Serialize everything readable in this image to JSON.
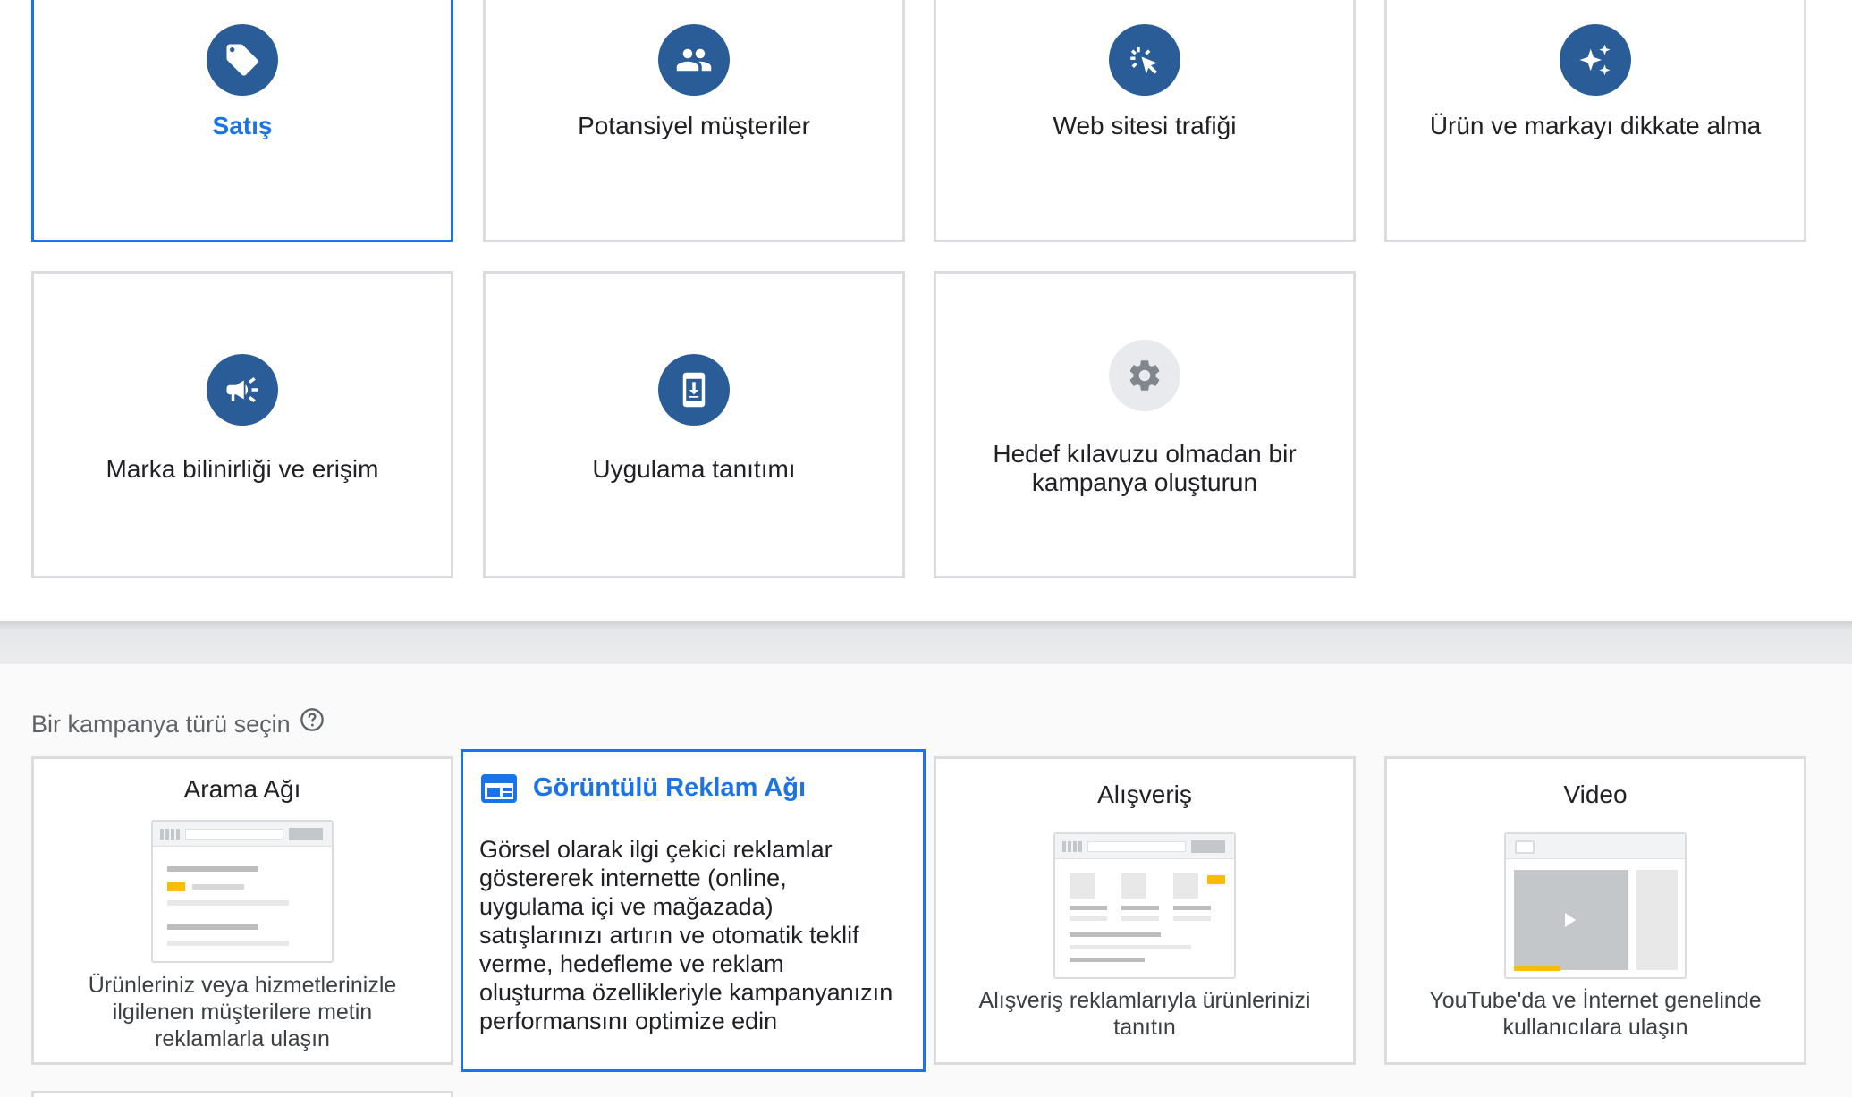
{
  "goals": [
    {
      "label": "Satış",
      "icon": "tag-icon",
      "selected": true
    },
    {
      "label": "Potansiyel müşteriler",
      "icon": "people-icon",
      "selected": false
    },
    {
      "label": "Web sitesi trafiği",
      "icon": "cursor-click-icon",
      "selected": false
    },
    {
      "label": "Ürün ve markayı dikkate alma",
      "icon": "sparkle-icon",
      "selected": false
    },
    {
      "label": "Marka bilinirliği ve erişim",
      "icon": "megaphone-icon",
      "selected": false
    },
    {
      "label": "Uygulama tanıtımı",
      "icon": "phone-download-icon",
      "selected": false
    },
    {
      "label_line1": "Hedef kılavuzu olmadan bir",
      "label_line2": "kampanya oluşturun",
      "icon": "gear-icon",
      "selected": false
    }
  ],
  "campaign_section": {
    "title": "Bir kampanya türü seçin",
    "help_icon": "help-circle-icon"
  },
  "campaign_types": [
    {
      "title": "Arama Ağı",
      "desc": [
        "Ürünleriniz veya hizmetlerinizle",
        "ilgilenen müşterilere metin",
        "reklamlarla ulaşın"
      ]
    },
    {
      "title": "Görüntülü Reklam Ağı",
      "icon": "display-network-icon",
      "selected": true,
      "desc": [
        "Görsel olarak ilgi çekici reklamlar",
        "göstererek internette (online,",
        "uygulama içi ve mağazada)",
        "satışlarınızı artırın ve otomatik teklif",
        "verme, hedefleme ve reklam",
        "oluşturma özellikleriyle kampanyanızın",
        "performansını optimize edin"
      ]
    },
    {
      "title": "Alışveriş",
      "desc": [
        "Alışveriş reklamlarıyla ürünlerinizi",
        "tanıtın"
      ]
    },
    {
      "title": "Video",
      "desc": [
        "YouTube'da ve İnternet genelinde",
        "kullanıcılara ulaşın"
      ]
    }
  ],
  "colors": {
    "accent": "#1a73e8",
    "icon_bg": "#2a5c98",
    "border": "#dadce0",
    "highlight_yellow": "#fbbc04"
  }
}
